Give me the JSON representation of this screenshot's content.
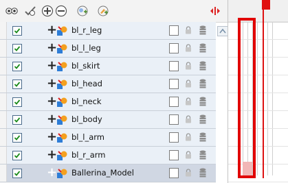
{
  "toolbar": {
    "buttons": [
      {
        "name": "show-all-icon"
      },
      {
        "name": "enable-all-icon"
      },
      {
        "name": "add-layer-icon"
      },
      {
        "name": "remove-layer-icon"
      },
      {
        "name": "add-peg-icon"
      },
      {
        "name": "add-drawing-icon"
      },
      {
        "name": "timeline-zoom-icon"
      }
    ]
  },
  "layers": [
    {
      "name": "bl_r_leg",
      "visible": true
    },
    {
      "name": "bl_l_leg",
      "visible": true
    },
    {
      "name": "bl_skirt",
      "visible": true
    },
    {
      "name": "bl_head",
      "visible": true
    },
    {
      "name": "bl_neck",
      "visible": true
    },
    {
      "name": "bl_body",
      "visible": true
    },
    {
      "name": "bl_l_arm",
      "visible": true
    },
    {
      "name": "bl_r_arm",
      "visible": true
    },
    {
      "name": "Ballerina_Model",
      "visible": true,
      "selected": true
    }
  ],
  "colors": {
    "highlight": "#e10000",
    "playhead": "#e01010",
    "row_bg": "#eaf0f7",
    "row_selected": "#d0d7e3"
  }
}
